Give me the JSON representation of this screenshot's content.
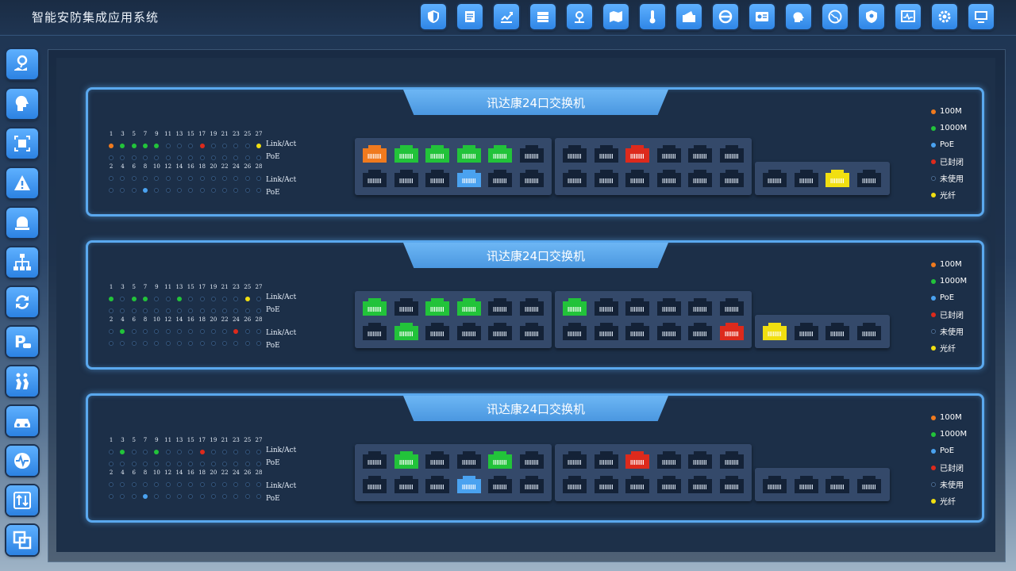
{
  "app_title": "智能安防集成应用系统",
  "colors": {
    "100M": "#f07a1e",
    "1000M": "#22c33a",
    "poe": "#4aa2f0",
    "closed": "#dd2a1c",
    "unused": "#1b2b42",
    "fiber": "#f1df11",
    "accent": "#4a9ff0"
  },
  "top_icons": [
    "shield-icon",
    "document-icon",
    "chart-icon",
    "server-icon",
    "location-icon",
    "map-icon",
    "thermometer-icon",
    "card-icon",
    "browser-icon",
    "id-card-icon",
    "head-icon",
    "globe-icon",
    "shield-location-icon",
    "monitor-pulse-icon",
    "gear-icon",
    "desktop-icon"
  ],
  "side_icons": [
    "map-pin-icon",
    "face-icon",
    "scanner-icon",
    "alert-icon",
    "alarm-bell-icon",
    "org-chart-icon",
    "refresh-icon",
    "parking-icon",
    "people-icon",
    "car-icon",
    "pulse-icon",
    "swap-icon",
    "layers-icon"
  ],
  "labels": {
    "link_act": "Link/Act",
    "poe": "PoE"
  },
  "legend": [
    {
      "key": "100M",
      "label": "100M"
    },
    {
      "key": "1000M",
      "label": "1000M"
    },
    {
      "key": "poe",
      "label": "PoE"
    },
    {
      "key": "closed",
      "label": "已封闭"
    },
    {
      "key": "unused",
      "label": "未使用"
    },
    {
      "key": "fiber",
      "label": "光纤"
    }
  ],
  "odd_numbers": [
    "1",
    "3",
    "5",
    "7",
    "9",
    "11",
    "13",
    "15",
    "17",
    "19",
    "21",
    "23",
    "25",
    "27"
  ],
  "even_numbers": [
    "2",
    "4",
    "6",
    "8",
    "10",
    "12",
    "14",
    "16",
    "18",
    "20",
    "22",
    "24",
    "26",
    "28"
  ],
  "switches": [
    {
      "title": "讯达康24口交换机",
      "link_odd": [
        "100M",
        "1000M",
        "1000M",
        "1000M",
        "1000M",
        "unused",
        "unused",
        "unused",
        "closed",
        "unused",
        "unused",
        "unused",
        "unused",
        "fiber"
      ],
      "poe_odd": [
        "unused",
        "unused",
        "unused",
        "unused",
        "unused",
        "unused",
        "unused",
        "unused",
        "unused",
        "unused",
        "unused",
        "unused",
        "unused",
        "unused"
      ],
      "link_even": [
        "unused",
        "unused",
        "unused",
        "unused",
        "unused",
        "unused",
        "unused",
        "unused",
        "unused",
        "unused",
        "unused",
        "unused",
        "unused",
        "unused"
      ],
      "poe_even": [
        "unused",
        "unused",
        "unused",
        "poe",
        "unused",
        "unused",
        "unused",
        "unused",
        "unused",
        "unused",
        "unused",
        "unused",
        "unused",
        "unused"
      ],
      "ports_top": [
        "100M",
        "1000M",
        "1000M",
        "1000M",
        "1000M",
        "unused",
        "unused",
        "unused",
        "closed",
        "unused",
        "unused",
        "unused"
      ],
      "ports_bottom": [
        "unused",
        "unused",
        "unused",
        "poe",
        "unused",
        "unused",
        "unused",
        "unused",
        "unused",
        "unused",
        "unused",
        "unused"
      ],
      "fiber_ports": [
        "unused",
        "unused",
        "fiber",
        "unused"
      ]
    },
    {
      "title": "讯达康24口交换机",
      "link_odd": [
        "1000M",
        "unused",
        "1000M",
        "1000M",
        "unused",
        "unused",
        "1000M",
        "unused",
        "unused",
        "unused",
        "unused",
        "unused",
        "fiber",
        "unused"
      ],
      "poe_odd": [
        "unused",
        "unused",
        "unused",
        "unused",
        "unused",
        "unused",
        "unused",
        "unused",
        "unused",
        "unused",
        "unused",
        "unused",
        "unused",
        "unused"
      ],
      "link_even": [
        "unused",
        "1000M",
        "unused",
        "unused",
        "unused",
        "unused",
        "unused",
        "unused",
        "unused",
        "unused",
        "unused",
        "closed",
        "unused",
        "unused"
      ],
      "poe_even": [
        "unused",
        "unused",
        "unused",
        "unused",
        "unused",
        "unused",
        "unused",
        "unused",
        "unused",
        "unused",
        "unused",
        "unused",
        "unused",
        "unused"
      ],
      "ports_top": [
        "1000M",
        "unused",
        "1000M",
        "1000M",
        "unused",
        "unused",
        "1000M",
        "unused",
        "unused",
        "unused",
        "unused",
        "unused"
      ],
      "ports_bottom": [
        "unused",
        "1000M",
        "unused",
        "unused",
        "unused",
        "unused",
        "unused",
        "unused",
        "unused",
        "unused",
        "unused",
        "closed"
      ],
      "fiber_ports": [
        "fiber",
        "unused",
        "unused",
        "unused"
      ]
    },
    {
      "title": "讯达康24口交换机",
      "link_odd": [
        "unused",
        "1000M",
        "unused",
        "unused",
        "1000M",
        "unused",
        "unused",
        "unused",
        "closed",
        "unused",
        "unused",
        "unused",
        "unused",
        "unused"
      ],
      "poe_odd": [
        "unused",
        "unused",
        "unused",
        "unused",
        "unused",
        "unused",
        "unused",
        "unused",
        "unused",
        "unused",
        "unused",
        "unused",
        "unused",
        "unused"
      ],
      "link_even": [
        "unused",
        "unused",
        "unused",
        "unused",
        "unused",
        "unused",
        "unused",
        "unused",
        "unused",
        "unused",
        "unused",
        "unused",
        "unused",
        "unused"
      ],
      "poe_even": [
        "unused",
        "unused",
        "unused",
        "poe",
        "unused",
        "unused",
        "unused",
        "unused",
        "unused",
        "unused",
        "unused",
        "unused",
        "unused",
        "unused"
      ],
      "ports_top": [
        "unused",
        "1000M",
        "unused",
        "unused",
        "1000M",
        "unused",
        "unused",
        "unused",
        "closed",
        "unused",
        "unused",
        "unused"
      ],
      "ports_bottom": [
        "unused",
        "unused",
        "unused",
        "poe",
        "unused",
        "unused",
        "unused",
        "unused",
        "unused",
        "unused",
        "unused",
        "unused"
      ],
      "fiber_ports": [
        "unused",
        "unused",
        "unused",
        "unused"
      ]
    }
  ]
}
